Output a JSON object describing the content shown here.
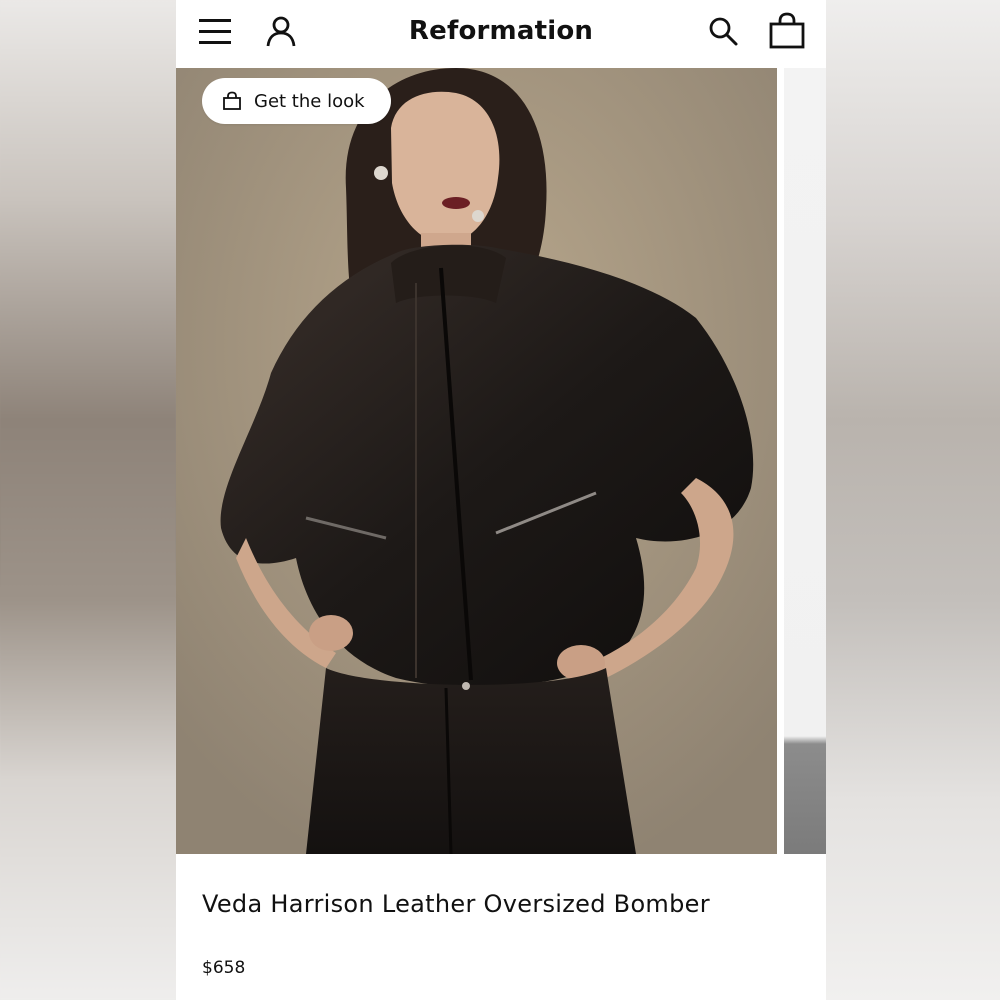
{
  "header": {
    "brand": "Reformation",
    "icons": [
      "menu-icon",
      "account-icon",
      "search-icon",
      "shopping-bag-icon"
    ]
  },
  "hero": {
    "get_the_look_label": "Get the look",
    "get_the_look_icon": "shopping-bag-icon"
  },
  "product": {
    "name": "Veda Harrison Leather Oversized Bomber",
    "price": "$658"
  },
  "colors": {
    "text": "#111111",
    "page_bg": "#ffffff",
    "hero_bg": "#a99a83"
  }
}
